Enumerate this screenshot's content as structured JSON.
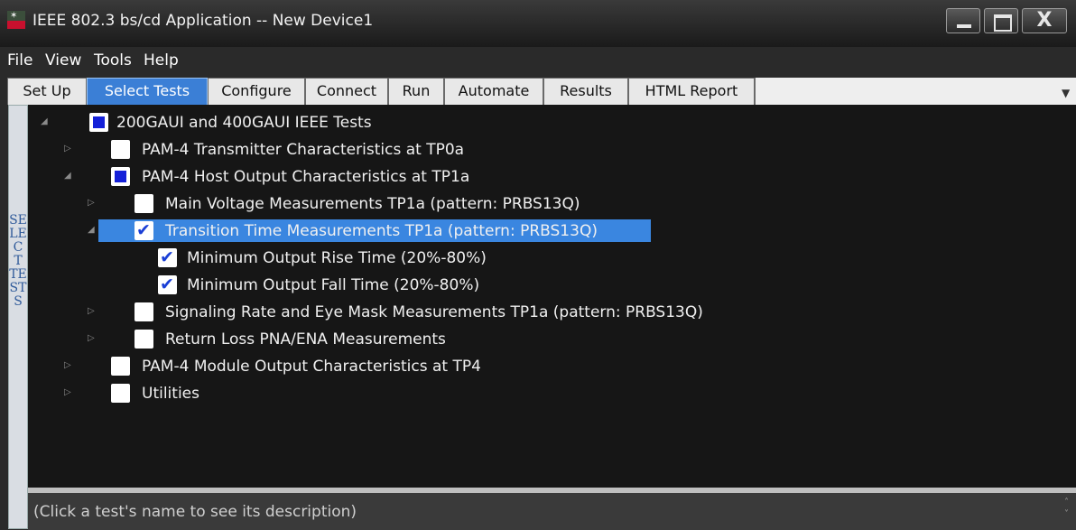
{
  "window": {
    "title": "IEEE 802.3 bs/cd Application -- New Device1"
  },
  "menu": [
    "File",
    "View",
    "Tools",
    "Help"
  ],
  "tabs": [
    "Set Up",
    "Select Tests",
    "Configure",
    "Connect",
    "Run",
    "Automate",
    "Results",
    "HTML Report"
  ],
  "active_tab": "Select Tests",
  "side_label": "SELECT TESTS",
  "tree": [
    {
      "label": "200GAUI and 400GAUI IEEE Tests",
      "state": "partial",
      "expanded": true
    },
    {
      "label": "PAM-4 Transmitter Characteristics at TP0a",
      "state": "unchecked",
      "expanded": false
    },
    {
      "label": "PAM-4 Host Output Characteristics at TP1a",
      "state": "partial",
      "expanded": true
    },
    {
      "label": "Main Voltage Measurements TP1a (pattern: PRBS13Q)",
      "state": "unchecked",
      "expanded": false
    },
    {
      "label": "Transition Time Measurements TP1a (pattern: PRBS13Q)",
      "state": "checked",
      "expanded": true,
      "selected": true
    },
    {
      "label": "Minimum Output Rise Time (20%-80%)",
      "state": "checked"
    },
    {
      "label": "Minimum Output Fall Time (20%-80%)",
      "state": "checked"
    },
    {
      "label": "Signaling Rate and Eye Mask Measurements TP1a (pattern: PRBS13Q)",
      "state": "unchecked",
      "expanded": false
    },
    {
      "label": "Return Loss PNA/ENA Measurements",
      "state": "unchecked",
      "expanded": false
    },
    {
      "label": "PAM-4 Module Output Characteristics at TP4",
      "state": "unchecked",
      "expanded": false
    },
    {
      "label": "Utilities",
      "state": "unchecked",
      "expanded": false
    }
  ],
  "description": "(Click a test's name to see its description)",
  "colors": {
    "accent": "#3b7fd6",
    "selection": "#3a86e0",
    "partial_fill": "#1420d8",
    "tree_bg": "#161616"
  }
}
